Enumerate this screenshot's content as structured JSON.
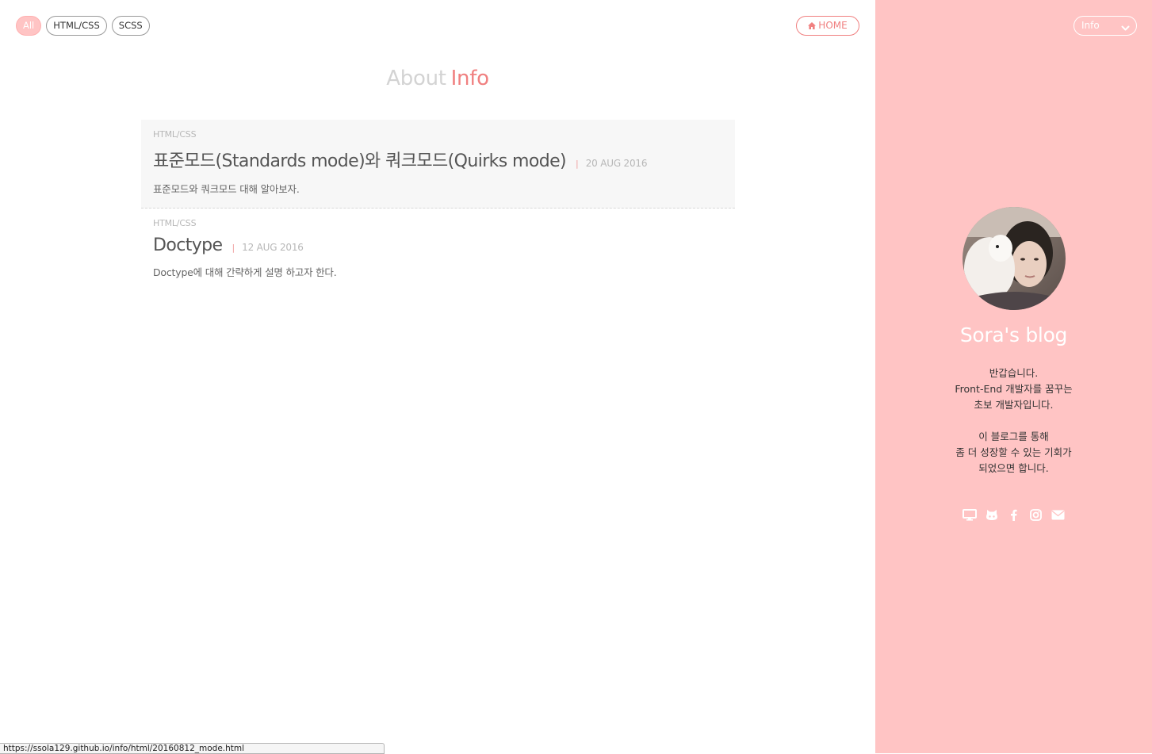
{
  "filters": [
    {
      "label": "All",
      "active": true
    },
    {
      "label": "HTML/CSS",
      "active": false
    },
    {
      "label": "SCSS",
      "active": false
    }
  ],
  "home_button": {
    "label": "HOME",
    "icon": "home-icon"
  },
  "heading": {
    "prefix": "About",
    "category": "Info"
  },
  "posts": [
    {
      "category": "HTML/CSS",
      "title": "표준모드(Standards mode)와 쿼크모드(Quirks mode)",
      "separator": "|",
      "date": "20 AUG 2016",
      "description": "표준모드와 쿼크모드 대해 알아보자."
    },
    {
      "category": "HTML/CSS",
      "title": "Doctype",
      "separator": "|",
      "date": "12 AUG 2016",
      "description": "Doctype에 대해 간략하게 설명 하고자 한다."
    }
  ],
  "status_url": "https://ssola129.github.io/info/html/20160812_mode.html",
  "sidebar": {
    "category_select": "Info",
    "blog_title": "Sora's blog",
    "bio": [
      "반갑습니다.",
      "Front-End 개발자를 꿈꾸는",
      "초보 개발자입니다.",
      "",
      "이 블로그를 통해",
      "좀 더 성장할 수 있는 기회가",
      "되었으면 합니다."
    ],
    "socials": [
      "desktop-icon",
      "github-icon",
      "facebook-icon",
      "instagram-icon",
      "envelope-icon"
    ]
  },
  "colors": {
    "accent": "#f08080",
    "sidebar_bg": "#ffc4c4",
    "active_chip": "#ffc4c4",
    "muted_text": "#b7b7b7"
  }
}
